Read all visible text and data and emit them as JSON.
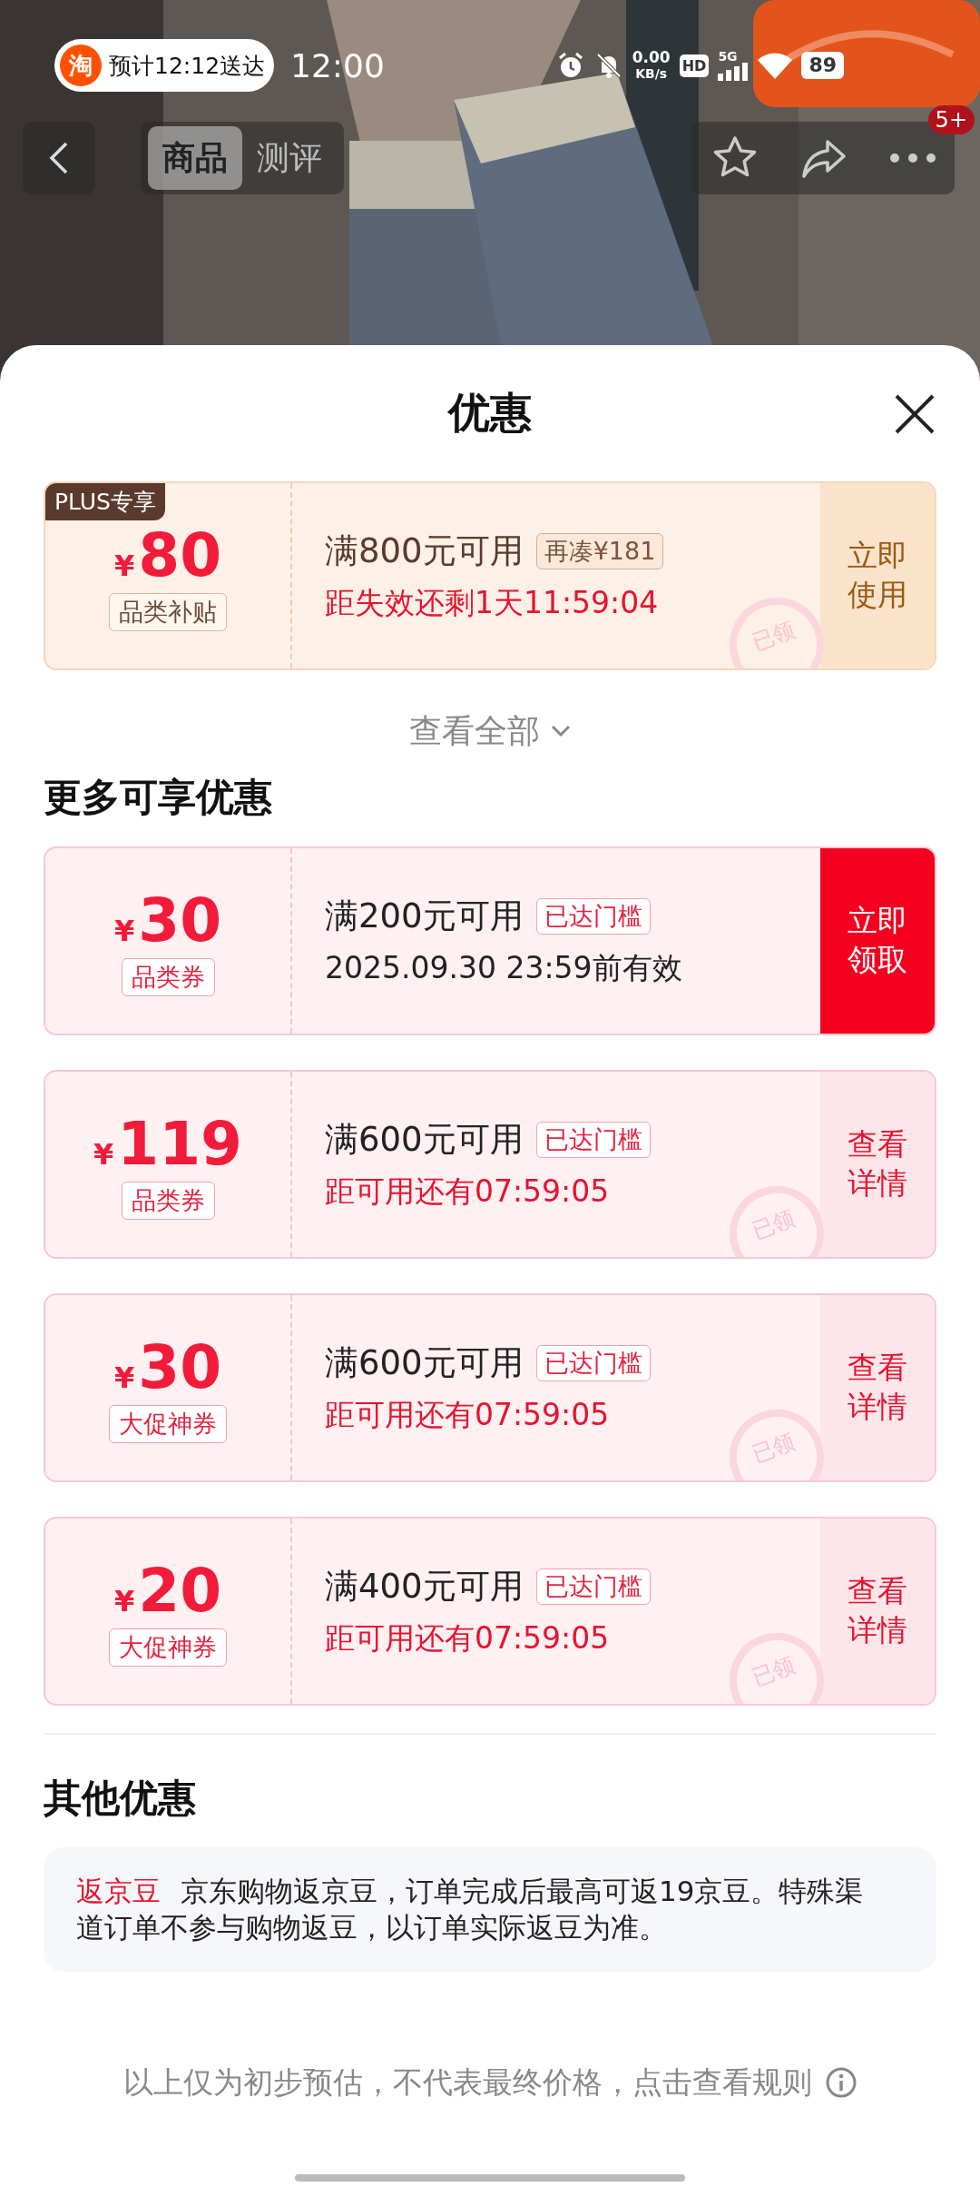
{
  "status_bar": {
    "app_pill": {
      "logo": "淘",
      "text": "预计12:12送达"
    },
    "time": "12:00",
    "net_speed": "0.00",
    "net_unit": "KB/s",
    "hd": "HD",
    "network": "5G",
    "battery": "89"
  },
  "nav": {
    "tabs": [
      {
        "label": "商品",
        "selected": true
      },
      {
        "label": "测评",
        "selected": false
      }
    ],
    "badge": "5+"
  },
  "sheet": {
    "title": "优惠",
    "top_coupons": [
      {
        "kind": "plus",
        "badge": "PLUS专享",
        "currency": "¥",
        "amount": "80",
        "type": "品类补贴",
        "condition": "满800元可用",
        "tag": "再凑¥181",
        "subline": "距失效还剩1天11:59:04",
        "urgent": true,
        "stamp": "已领",
        "action": {
          "label": "立即使用",
          "kind": "soft"
        }
      }
    ],
    "show_all": "查看全部",
    "more_title": "更多可享优惠",
    "coupons": [
      {
        "kind": "normal",
        "currency": "¥",
        "amount": "30",
        "type": "品类券",
        "condition": "满200元可用",
        "tag": "已达门槛",
        "subline": "2025.09.30 23:59前有效",
        "urgent": false,
        "action": {
          "label": "立即领取",
          "kind": "filled"
        }
      },
      {
        "kind": "normal",
        "currency": "¥",
        "amount": "119",
        "type": "品类券",
        "condition": "满600元可用",
        "tag": "已达门槛",
        "subline": "距可用还有07:59:05",
        "urgent": true,
        "stamp": "已领",
        "action": {
          "label": "查看详情",
          "kind": "soft"
        }
      },
      {
        "kind": "normal",
        "currency": "¥",
        "amount": "30",
        "type": "大促神券",
        "condition": "满600元可用",
        "tag": "已达门槛",
        "subline": "距可用还有07:59:05",
        "urgent": true,
        "stamp": "已领",
        "action": {
          "label": "查看详情",
          "kind": "soft"
        }
      },
      {
        "kind": "normal",
        "currency": "¥",
        "amount": "20",
        "type": "大促神券",
        "condition": "满400元可用",
        "tag": "已达门槛",
        "subline": "距可用还有07:59:05",
        "urgent": true,
        "stamp": "已领",
        "action": {
          "label": "查看详情",
          "kind": "soft"
        }
      }
    ],
    "other_title": "其他优惠",
    "rebate": {
      "label": "返京豆",
      "text": "京东购物返京豆，订单完成后最高可返19京豆。特殊渠道订单不参与购物返豆，以订单实际返豆为准。"
    },
    "footer": "以上仅为初步预估，不代表最终价格，点击查看规则"
  }
}
